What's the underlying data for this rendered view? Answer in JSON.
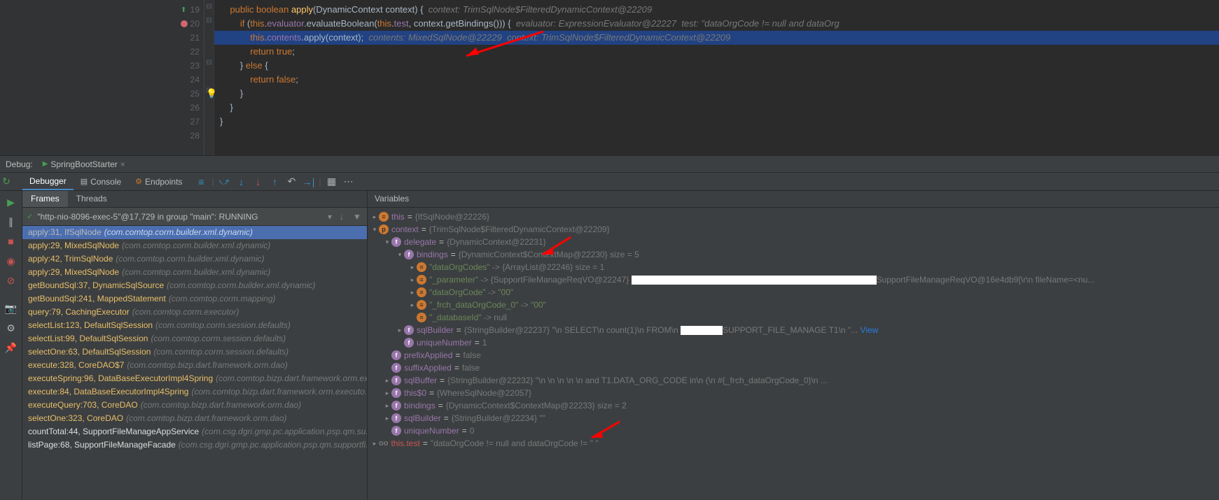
{
  "editor": {
    "lines": [
      {
        "n": 19,
        "marker": "green"
      },
      {
        "n": 20,
        "marker": "red"
      },
      {
        "n": 21,
        "hl": true
      },
      {
        "n": 22
      },
      {
        "n": 23
      },
      {
        "n": 24
      },
      {
        "n": 25,
        "bulb": true
      },
      {
        "n": 26
      },
      {
        "n": 27
      },
      {
        "n": 28
      }
    ],
    "code19_kw1": "public",
    "code19_kw2": "boolean",
    "code19_fn": "apply",
    "code19_rest": "(DynamicContext context) {",
    "code19_hint": "  context: TrimSqlNode$FilteredDynamicContext@22209",
    "code20_kw": "if",
    "code20_this": "this",
    "code20_a": ".",
    "code20_f1": "evaluator",
    "code20_b": ".evaluateBoolean(",
    "code20_this2": "this",
    "code20_c": ".",
    "code20_f2": "test",
    "code20_d": ", context.getBindings())) {",
    "code20_hint": "  evaluator: ExpressionEvaluator@22227  test: \"dataOrgCode != null and dataOrg",
    "code21_this": "this",
    "code21_a": ".",
    "code21_f": "contents",
    "code21_b": ".apply(context);",
    "code21_hint": "  contents: MixedSqlNode@22229  context: TrimSqlNode$FilteredDynamicContext@22209",
    "code22_kw": "return",
    "code22_v": "true",
    "code22_s": ";",
    "code23_a": "} ",
    "code23_kw": "else",
    "code23_b": " {",
    "code24_kw": "return",
    "code24_v": "false",
    "code24_s": ";",
    "code25": "}",
    "code26": "}",
    "code27": "}"
  },
  "debug": {
    "label": "Debug:",
    "config": "SpringBootStarter",
    "tabs": {
      "debugger": "Debugger",
      "console": "Console",
      "endpoints": "Endpoints"
    },
    "frames_tab": "Frames",
    "threads_tab": "Threads",
    "thread": "\"http-nio-8096-exec-5\"@17,729 in group \"main\": RUNNING",
    "variables_label": "Variables"
  },
  "frames": [
    {
      "sel": true,
      "main": "apply:31, IfSqlNode",
      "path": "(com.comtop.corm.builder.xml.dynamic)"
    },
    {
      "y": true,
      "main": "apply:29, MixedSqlNode",
      "path": "(com.comtop.corm.builder.xml.dynamic)"
    },
    {
      "y": true,
      "main": "apply:42, TrimSqlNode",
      "path": "(com.comtop.corm.builder.xml.dynamic)"
    },
    {
      "y": true,
      "main": "apply:29, MixedSqlNode",
      "path": "(com.comtop.corm.builder.xml.dynamic)"
    },
    {
      "y": true,
      "main": "getBoundSql:37, DynamicSqlSource",
      "path": "(com.comtop.corm.builder.xml.dynamic)"
    },
    {
      "y": true,
      "main": "getBoundSql:241, MappedStatement",
      "path": "(com.comtop.corm.mapping)"
    },
    {
      "y": true,
      "main": "query:79, CachingExecutor",
      "path": "(com.comtop.corm.executor)"
    },
    {
      "y": true,
      "main": "selectList:123, DefaultSqlSession",
      "path": "(com.comtop.corm.session.defaults)"
    },
    {
      "y": true,
      "main": "selectList:99, DefaultSqlSession",
      "path": "(com.comtop.corm.session.defaults)"
    },
    {
      "y": true,
      "main": "selectOne:63, DefaultSqlSession",
      "path": "(com.comtop.corm.session.defaults)"
    },
    {
      "y": true,
      "main": "execute:328, CoreDAO$7",
      "path": "(com.comtop.bizp.dart.framework.orm.dao)"
    },
    {
      "y": true,
      "main": "executeSpring:96, DataBaseExecutorImpl4Spring",
      "path": "(com.comtop.bizp.dart.framework.orm.ex..."
    },
    {
      "y": true,
      "main": "execute:84, DataBaseExecutorImpl4Spring",
      "path": "(com.comtop.bizp.dart.framework.orm.executo..."
    },
    {
      "y": true,
      "main": "executeQuery:703, CoreDAO",
      "path": "(com.comtop.bizp.dart.framework.orm.dao)"
    },
    {
      "y": true,
      "main": "selectOne:323, CoreDAO",
      "path": "(com.comtop.bizp.dart.framework.orm.dao)"
    },
    {
      "w": true,
      "main": "countTotal:44, SupportFileManageAppService",
      "path": "(com.csg.dgri.gmp.pc.application.psp.qm.su..."
    },
    {
      "w": true,
      "main": "listPage:68, SupportFileManageFacade",
      "path": "(com.csg.dgri.gmp.pc.application.psp.qm.supportfi..."
    }
  ],
  "vars": {
    "r0": {
      "name": "this",
      "val": "{IfSqlNode@22226}"
    },
    "r1": {
      "name": "context",
      "val": "{TrimSqlNode$FilteredDynamicContext@22209}"
    },
    "r2": {
      "name": "delegate",
      "val": "{DynamicContext@22231}"
    },
    "r3": {
      "name": "bindings",
      "val": "{DynamicContext$ContextMap@22230}",
      "extra": "size = 5"
    },
    "r4": {
      "name": "\"dataOrgCodes\"",
      "arrow": "->",
      "val": "{ArrayList@22246}",
      "extra": "size = 1"
    },
    "r5": {
      "name": "\"_parameter\"",
      "arrow": "->",
      "val": "{SupportFileManageReqVO@22247}",
      "tail": "SupportFileManageReqVO@16e4db9[\\r\\n  fileName=<nu..."
    },
    "r6": {
      "name": "\"dataOrgCode\"",
      "arrow": "->",
      "val": "\"00\""
    },
    "r7": {
      "name": "\"_frch_dataOrgCode_0\"",
      "arrow": "->",
      "val": "\"00\""
    },
    "r8": {
      "name": "\"_databaseId\"",
      "arrow": "->",
      "val": "null"
    },
    "r9": {
      "name": "sqlBuilder",
      "val": "{StringBuilder@22237} \"\\n        SELECT\\n            count(1)\\n        FROM\\n            ",
      "tail": "SUPPORT_FILE_MANAGE T1\\n        \"...",
      "view": "View"
    },
    "r10": {
      "name": "uniqueNumber",
      "val": "1"
    },
    "r11": {
      "name": "prefixApplied",
      "val": "false"
    },
    "r12": {
      "name": "suffixApplied",
      "val": "false"
    },
    "r13": {
      "name": "sqlBuffer",
      "val": "{StringBuilder@22232} \"\\n            \\n            \\n            \\n            \\n             and T1.DATA_ORG_CODE in\\n            (\\n                #{_frch_dataOrgCode_0}\\n ..."
    },
    "r14": {
      "name": "this$0",
      "val": "{WhereSqlNode@22057}"
    },
    "r15": {
      "name": "bindings",
      "val": "{DynamicContext$ContextMap@22233}",
      "extra": "size = 2"
    },
    "r16": {
      "name": "sqlBuilder",
      "val": "{StringBuilder@22234} \"\""
    },
    "r17": {
      "name": "uniqueNumber",
      "val": "0"
    },
    "r18": {
      "name": "this.test",
      "val": "\"dataOrgCode != null and dataOrgCode != '' \""
    }
  }
}
